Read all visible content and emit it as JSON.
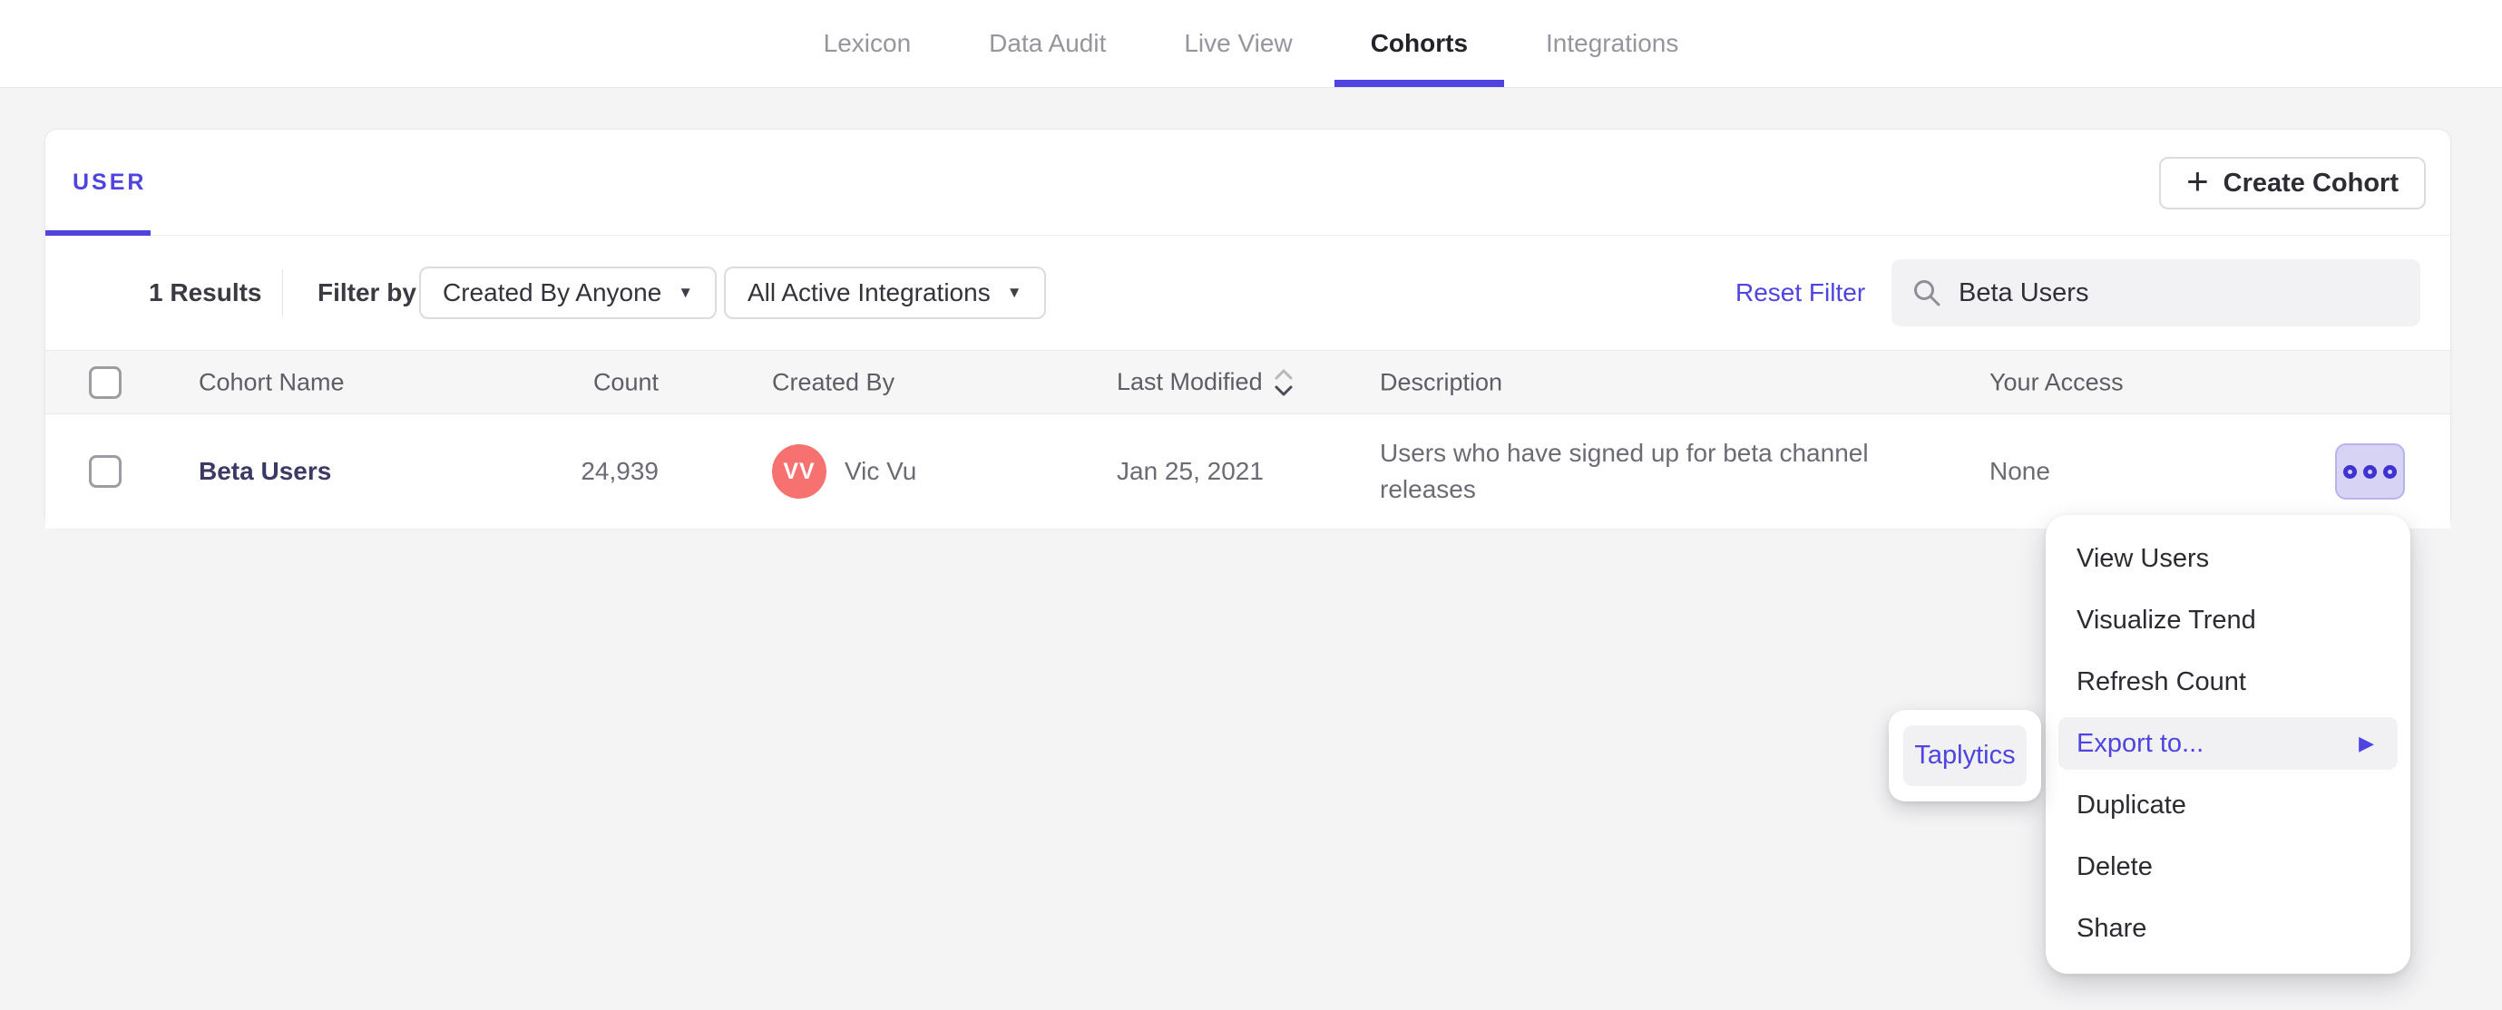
{
  "nav": {
    "items": [
      {
        "label": "Lexicon",
        "active": false
      },
      {
        "label": "Data Audit",
        "active": false
      },
      {
        "label": "Live View",
        "active": false
      },
      {
        "label": "Cohorts",
        "active": true
      },
      {
        "label": "Integrations",
        "active": false
      }
    ]
  },
  "card": {
    "tab_label": "USER",
    "create_button_label": "Create Cohort",
    "filters": {
      "results": "1 Results",
      "filter_by": "Filter by",
      "created_by_dropdown": "Created By Anyone",
      "integrations_dropdown": "All Active Integrations",
      "reset_link": "Reset Filter",
      "search_value": "Beta Users"
    },
    "table": {
      "headers": {
        "name": "Cohort Name",
        "count": "Count",
        "created_by": "Created By",
        "last_modified": "Last Modified",
        "description": "Description",
        "access": "Your Access"
      },
      "row": {
        "name": "Beta Users",
        "count": "24,939",
        "creator_initials": "VV",
        "creator_name": "Vic Vu",
        "last_modified": "Jan 25, 2021",
        "description": "Users who have signed up for beta channel releases",
        "access": "None"
      }
    }
  },
  "menu": {
    "items": {
      "view_users": "View Users",
      "visualize_trend": "Visualize Trend",
      "refresh_count": "Refresh Count",
      "export_to": "Export to...",
      "duplicate": "Duplicate",
      "delete": "Delete",
      "share": "Share"
    },
    "highlighted_item": "Export to..."
  },
  "submenu": {
    "taplytics": "Taplytics"
  },
  "colors": {
    "accent_purple": "#4f44e0",
    "cohort_name": "#3d3965",
    "avatar_background": "#f77171",
    "page_background": "#f4f4f5",
    "table_header_background": "#f6f6f7"
  }
}
